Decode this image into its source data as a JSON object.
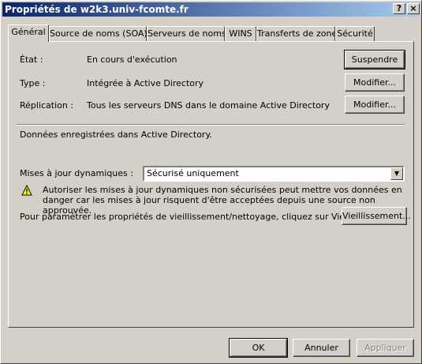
{
  "window": {
    "title": "Propriétés de w2k3.univ-fcomte.fr",
    "help_button": "?",
    "close_button": "×"
  },
  "tabs": [
    {
      "label": "Général"
    },
    {
      "label": "Source de noms (SOA)"
    },
    {
      "label": "Serveurs de noms"
    },
    {
      "label": "WINS"
    },
    {
      "label": "Transferts de zone"
    },
    {
      "label": "Sécurité"
    }
  ],
  "general": {
    "state_label": "État :",
    "state_value": "En cours d'exécution",
    "suspend_button": "Suspendre",
    "type_label": "Type :",
    "type_value": "Intégrée à Active Directory",
    "type_modify_button": "Modifier...",
    "replication_label": "Réplication :",
    "replication_value": "Tous les serveurs DNS dans le domaine Active Directory",
    "replication_modify_button": "Modifier...",
    "stored_text": "Données enregistrées dans Active Directory.",
    "dynamic_updates_label": "Mises à jour dynamiques :",
    "dynamic_updates_value": "Sécurisé uniquement",
    "warning_text": "Autoriser les mises à jour dynamiques non sécurisées peut mettre vos données en danger car les mises à jour risquent d'être acceptées depuis une source non approuvée.",
    "aging_text": "Pour paramétrer les propriétés de vieillissement/nettoyage, cliquez sur Vieillissement.",
    "aging_button": "Vieillissement..."
  },
  "footer": {
    "ok": "OK",
    "cancel": "Annuler",
    "apply": "Appliquer"
  }
}
